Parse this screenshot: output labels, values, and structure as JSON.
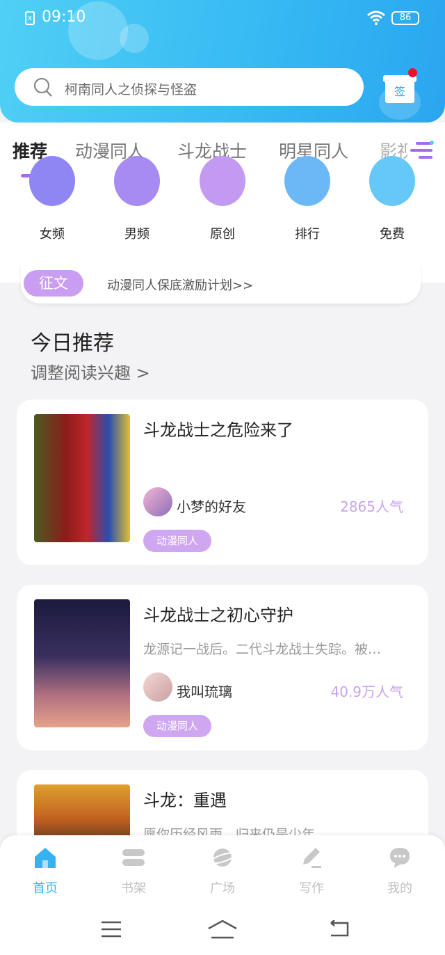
{
  "status_bar": {
    "time": "09:10",
    "battery": "86",
    "sim_label": "x"
  },
  "search": {
    "placeholder": "柯南同人之侦探与怪盗"
  },
  "sign_button": {
    "label": "签"
  },
  "tabs": [
    {
      "label": "推荐",
      "active": true
    },
    {
      "label": "动漫同人"
    },
    {
      "label": "斗龙战士"
    },
    {
      "label": "明星同人"
    },
    {
      "label": "影视"
    }
  ],
  "categories": [
    {
      "label": "女频",
      "color": "#8f86f3"
    },
    {
      "label": "男频",
      "color": "#a78bf3"
    },
    {
      "label": "原创",
      "color": "#c39af2"
    },
    {
      "label": "排行",
      "color": "#6cb8f6"
    },
    {
      "label": "免费",
      "color": "#65c8f7"
    }
  ],
  "banner": {
    "tag": "征文",
    "text": "动漫同人保底激励计划>>"
  },
  "section": {
    "title": "今日推荐",
    "subtitle": "调整阅读兴趣 >"
  },
  "books": [
    {
      "title": "斗龙战士之危险来了",
      "description": "",
      "author": "小梦的好友",
      "popularity": "2865人气",
      "genre": "动漫同人"
    },
    {
      "title": "斗龙战士之初心守护",
      "description": "龙源记一战后。二代斗龙战士失踪。被…",
      "author": "我叫琉璃",
      "popularity": "40.9万人气",
      "genre": "动漫同人"
    },
    {
      "title": "斗龙：重遇",
      "description": "愿你历经风雨，归来仍是少年……",
      "author": "",
      "popularity": "",
      "genre": ""
    }
  ],
  "bottom_nav": [
    {
      "label": "首页",
      "icon": "home-icon",
      "active": true
    },
    {
      "label": "书架",
      "icon": "bookshelf-icon"
    },
    {
      "label": "广场",
      "icon": "planet-icon"
    },
    {
      "label": "写作",
      "icon": "pen-icon"
    },
    {
      "label": "我的",
      "icon": "chat-bubble-icon"
    }
  ],
  "colors": {
    "accent_blue": "#36b2f3",
    "accent_purple": "#a36bf0",
    "tag_purple": "#cfa7f0"
  }
}
